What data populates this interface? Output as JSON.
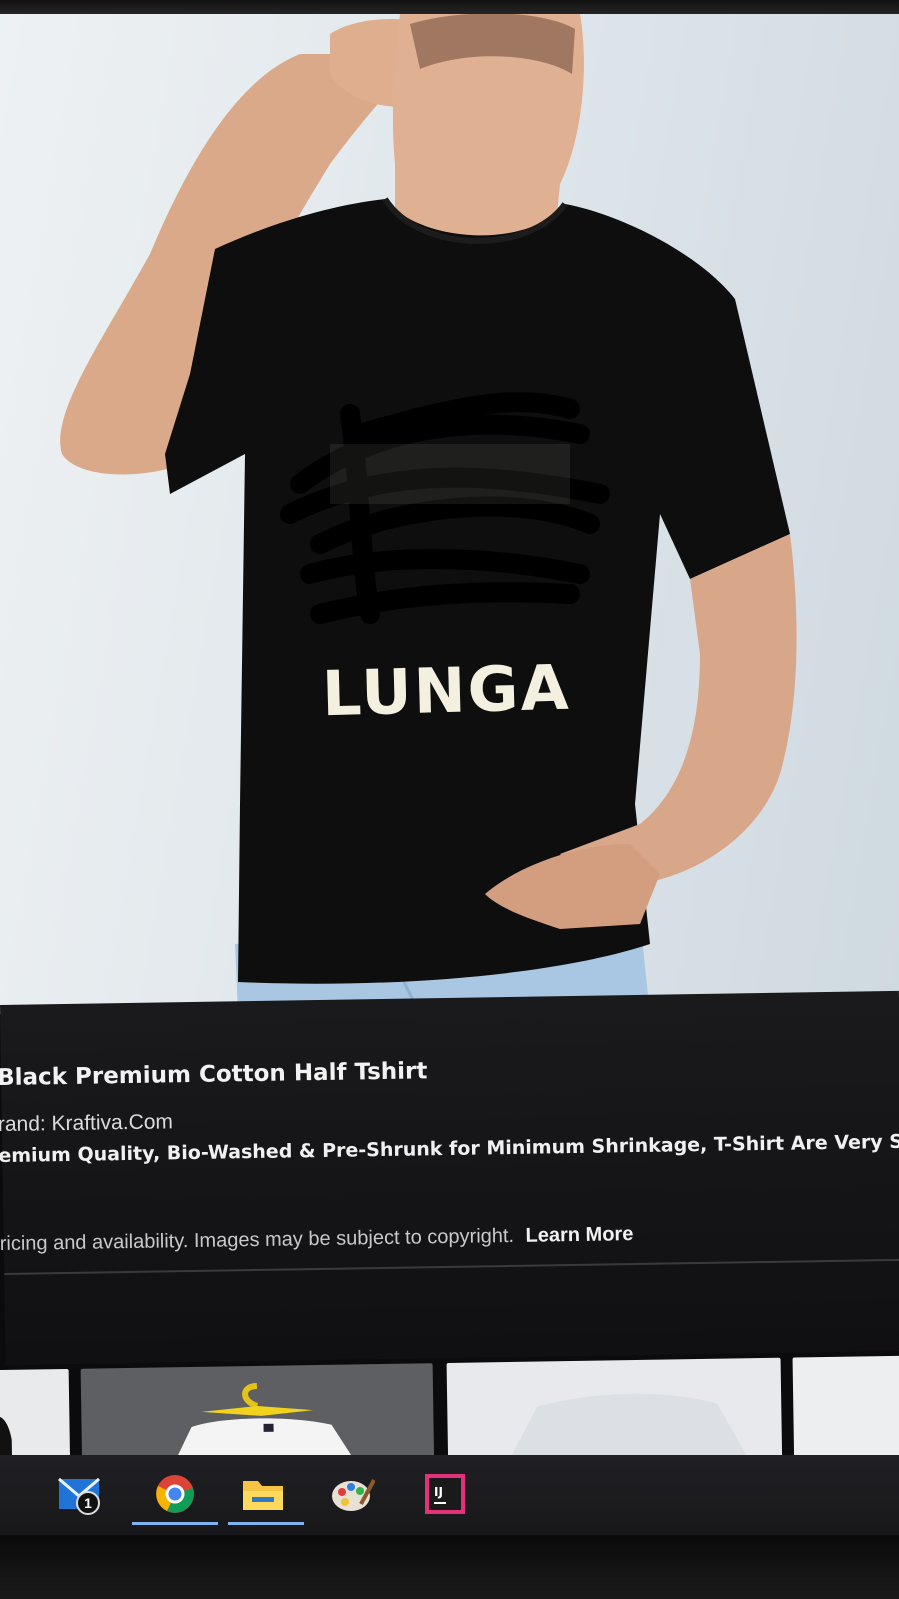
{
  "product": {
    "print_text": "LUNGA",
    "title": "Black Premium Cotton Half Tshirt",
    "brand": "rand: Kraftiva.Com",
    "description": "emium Quality, Bio-Washed & Pre-Shrunk for Minimum Shrinkage, T-Shirt Are Very So",
    "notice": "ricing and availability. Images may be subject to copyright.",
    "learn_more": "Learn More"
  },
  "taskbar": {
    "apps": [
      {
        "name": "mail-icon",
        "badge": "1"
      },
      {
        "name": "chrome-icon"
      },
      {
        "name": "file-explorer-icon"
      },
      {
        "name": "paint-icon"
      },
      {
        "name": "intellij-icon",
        "label": "IJ"
      }
    ]
  },
  "colors": {
    "panel": "#1a1a1c",
    "shirt": "#0e0e0e",
    "jeans": "#a9c7e3",
    "accent": "#7fb2f0"
  }
}
